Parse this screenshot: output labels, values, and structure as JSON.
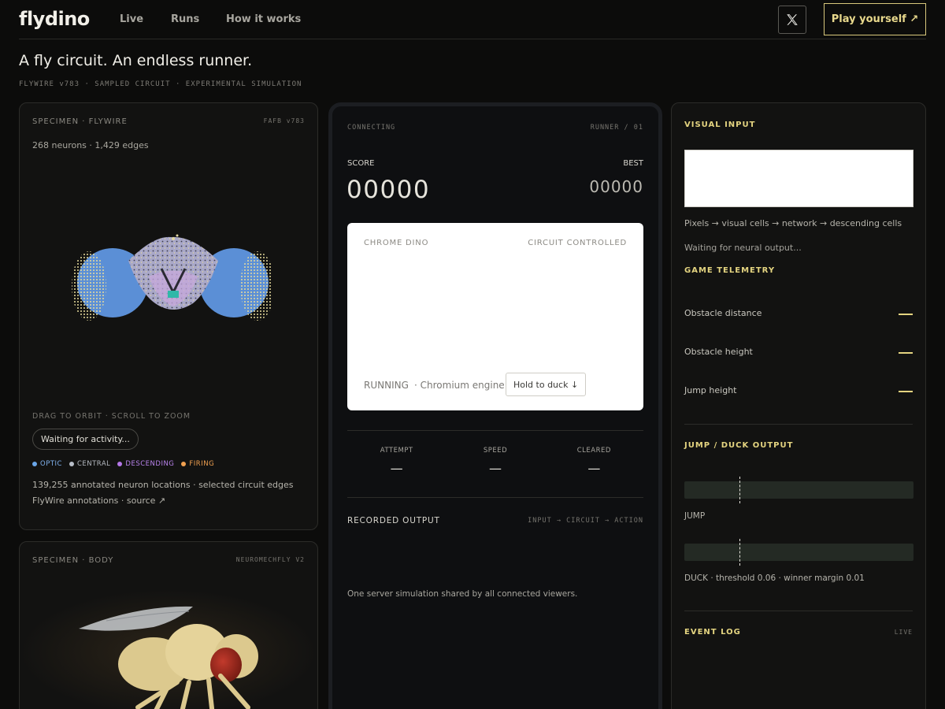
{
  "nav": {
    "logo": "flydino",
    "links": [
      "Live",
      "Runs",
      "How it works"
    ],
    "play_label": "Play yourself ↗"
  },
  "hero": {
    "title": "A fly circuit. An endless runner.",
    "subtitle": "FLYWIRE v783 · SAMPLED CIRCUIT · EXPERIMENTAL SIMULATION"
  },
  "specimen_flywire": {
    "title": "SPECIMEN · FLYWIRE",
    "tag": "FAFB v783",
    "stats": "268 neurons · 1,429 edges",
    "hint": "DRAG TO ORBIT · SCROLL TO ZOOM",
    "status": "Waiting for activity...",
    "legend": [
      {
        "label": "OPTIC",
        "color": "#6aa6e8"
      },
      {
        "label": "CENTRAL",
        "color": "#b8bec8"
      },
      {
        "label": "DESCENDING",
        "color": "#b477e8"
      },
      {
        "label": "FIRING",
        "color": "#f0a050"
      }
    ],
    "footnote_1": "139,255 annotated neuron locations · selected circuit edges",
    "footnote_2": "FlyWire annotations · source ↗"
  },
  "specimen_body": {
    "title": "SPECIMEN · BODY",
    "tag": "NEUROMECHFLY V2"
  },
  "runner": {
    "status": "CONNECTING",
    "tag": "RUNNER / 01",
    "score_label": "SCORE",
    "best_label": "BEST",
    "score": "00000",
    "best": "00000",
    "game": {
      "left_label": "CHROME DINO",
      "right_label": "CIRCUIT CONTROLLED",
      "state": "RUNNING",
      "engine": "· Chromium engine",
      "duck_button": "Hold to duck ↓"
    },
    "stats": [
      {
        "label": "ATTEMPT",
        "value": "—"
      },
      {
        "label": "SPEED",
        "value": "—"
      },
      {
        "label": "CLEARED",
        "value": "—"
      }
    ],
    "recorded_title": "RECORDED OUTPUT",
    "recorded_flow": "INPUT → CIRCUIT → ACTION",
    "note": "One server simulation shared by all connected viewers."
  },
  "right": {
    "visual_title": "VISUAL INPUT",
    "pipeline": "Pixels → visual cells → network → descending cells",
    "waiting": "Waiting for neural output...",
    "telemetry_title": "GAME TELEMETRY",
    "telemetry": [
      {
        "label": "Obstacle distance"
      },
      {
        "label": "Obstacle height"
      },
      {
        "label": "Jump height"
      }
    ],
    "output_title": "JUMP / DUCK OUTPUT",
    "jump_label": "JUMP",
    "duck_label": "DUCK · threshold 0.06 · winner margin 0.01",
    "event_title": "EVENT LOG",
    "event_tag": "LIVE"
  },
  "colors": {
    "accent": "#e4d480",
    "background": "#0c0c0b"
  }
}
